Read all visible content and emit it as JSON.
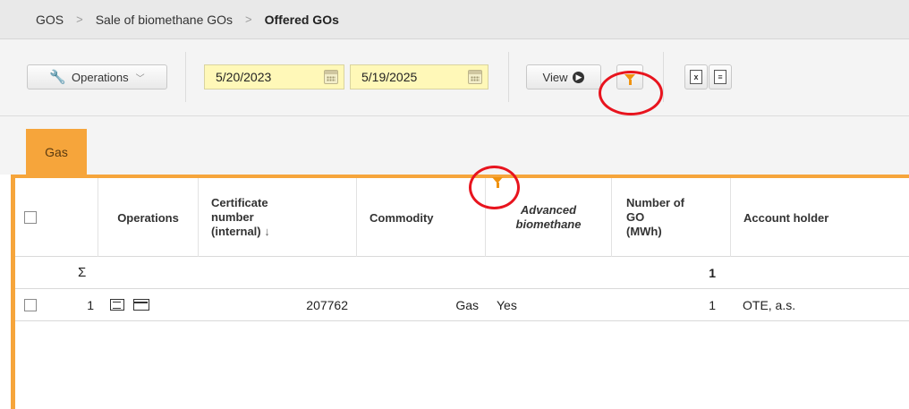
{
  "breadcrumb": {
    "items": [
      "GOS",
      "Sale of biomethane GOs",
      "Offered GOs"
    ],
    "separator": ">"
  },
  "toolbar": {
    "operations_label": "Operations",
    "date_from": "5/20/2023",
    "date_to": "5/19/2025",
    "view_label": "View"
  },
  "tabs": [
    {
      "label": "Gas",
      "active": true
    }
  ],
  "table": {
    "columns": [
      "Operations",
      "Certificate number (internal)",
      "Commodity",
      "Advanced biomethane",
      "Number of GO (MWh)",
      "Account holder"
    ],
    "header_lines": {
      "certificate": [
        "Certificate",
        "number",
        "(internal)"
      ],
      "certificate_sort_icon": "↓",
      "advanced": [
        "Advanced",
        "biomethane"
      ],
      "number_of_go": [
        "Number of",
        "GO",
        "(MWh)"
      ]
    },
    "sum_symbol": "Σ",
    "sum_number_of_go": "1",
    "rows": [
      {
        "index": "1",
        "certificate": "207762",
        "commodity": "Gas",
        "advanced": "Yes",
        "number_of_go": "1",
        "account_holder": "OTE, a.s."
      }
    ]
  },
  "colors": {
    "accent_orange": "#f6a53b",
    "filter_orange": "#f0920f",
    "highlight_red": "#e8141e",
    "date_yellow": "#fff8b8"
  }
}
